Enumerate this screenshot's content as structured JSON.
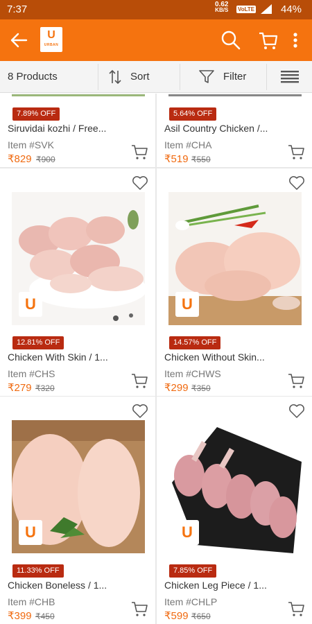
{
  "status_bar": {
    "time": "7:37",
    "speed_value": "0.62",
    "speed_unit": "KB/S",
    "volte": "VoLTE",
    "battery": "44%"
  },
  "app_bar": {
    "logo_letter": "U",
    "logo_word": "URBAN",
    "accent_color": "#f5730f"
  },
  "toolbar": {
    "product_count": "8 Products",
    "sort_label": "Sort",
    "filter_label": "Filter"
  },
  "products": [
    {
      "discount": "7.89% OFF",
      "name": "Siruvidai kozhi / Free...",
      "sku": "Item #SVK",
      "price": "₹829",
      "mrp": "₹900"
    },
    {
      "discount": "5.64% OFF",
      "name": "Asil Country Chicken /...",
      "sku": "Item #CHA",
      "price": "₹519",
      "mrp": "₹550"
    },
    {
      "discount": "12.81% OFF",
      "name": "Chicken With Skin / 1...",
      "sku": "Item #CHS",
      "price": "₹279",
      "mrp": "₹320"
    },
    {
      "discount": "14.57% OFF",
      "name": "Chicken Without Skin...",
      "sku": "Item #CHWS",
      "price": "₹299",
      "mrp": "₹350"
    },
    {
      "discount": "11.33% OFF",
      "name": "Chicken Boneless / 1...",
      "sku": "Item #CHB",
      "price": "₹399",
      "mrp": "₹450"
    },
    {
      "discount": "7.85% OFF",
      "name": "Chicken Leg Piece / 1...",
      "sku": "Item #CHLP",
      "price": "₹599",
      "mrp": "₹650"
    }
  ]
}
